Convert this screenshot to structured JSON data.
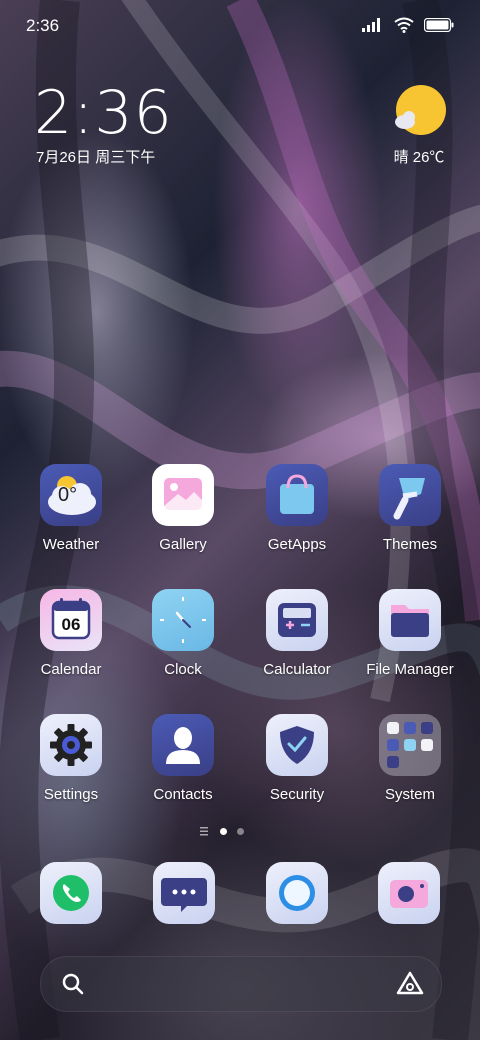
{
  "status_bar": {
    "time": "2:36"
  },
  "lockwidget": {
    "clock": "2:36",
    "date": "7月26日 周三下午"
  },
  "weather_widget": {
    "condition_temp": "晴 26℃"
  },
  "apps": [
    {
      "label": "Weather",
      "badge_text": "0°"
    },
    {
      "label": "Gallery"
    },
    {
      "label": "GetApps"
    },
    {
      "label": "Themes"
    },
    {
      "label": "Calendar",
      "day": "06"
    },
    {
      "label": "Clock"
    },
    {
      "label": "Calculator"
    },
    {
      "label": "File Manager"
    },
    {
      "label": "Settings"
    },
    {
      "label": "Contacts"
    },
    {
      "label": "Security"
    },
    {
      "label": "System"
    }
  ],
  "dock": [
    {
      "icon": "phone-icon"
    },
    {
      "icon": "messages-icon"
    },
    {
      "icon": "browser-icon"
    },
    {
      "icon": "camera-icon"
    }
  ],
  "page_indicator": {
    "pages": 2,
    "active": 1
  },
  "colors": {
    "accent_blue": "#3d4a9a",
    "weather_sun": "#f7c531",
    "phone_green": "#1fbf6a"
  }
}
